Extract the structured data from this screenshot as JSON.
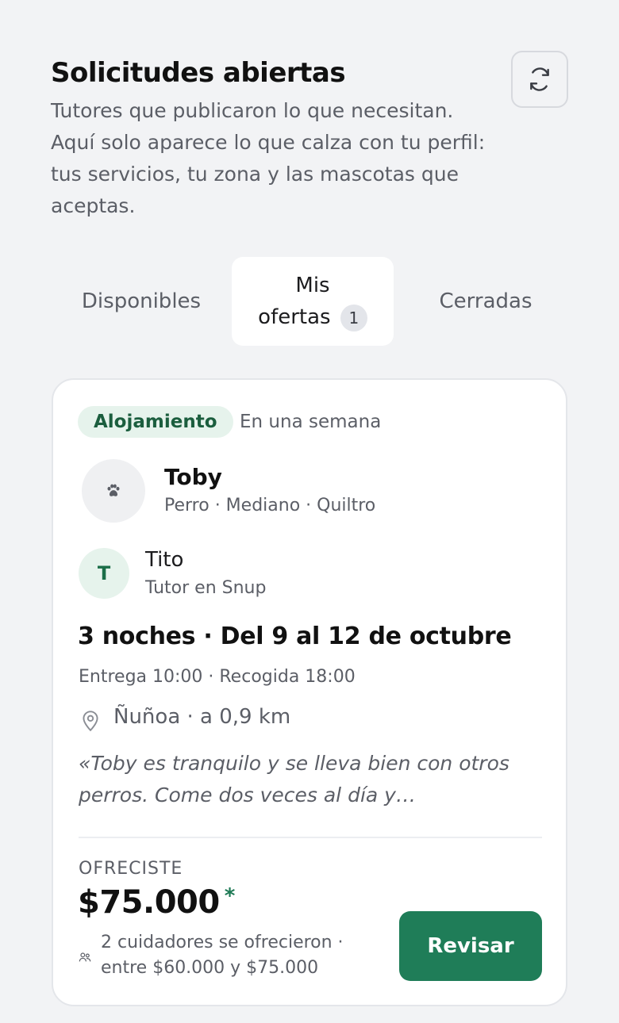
{
  "header": {
    "title": "Solicitudes abiertas",
    "subtitle": "Tutores que publicaron lo que necesitan. Aquí solo aparece lo que calza con tu perfil: tus servicios, tu zona y las mascotas que aceptas.",
    "refresh_icon": "refresh-icon"
  },
  "tabs": {
    "available": "Disponibles",
    "mine_line1": "Mis",
    "mine_line2": "ofertas",
    "mine_count": "1",
    "closed": "Cerradas",
    "active": "mine"
  },
  "card": {
    "service": "Alojamiento",
    "when": "En una semana",
    "pet_icon": "paw-icon",
    "pet_name": "Toby",
    "pet_meta": "Perro · Mediano · Quiltro",
    "owner_initial": "T",
    "owner_name": "Tito",
    "owner_role": "Tutor en Snup",
    "stay": "3 noches · Del 9 al 12 de octubre",
    "times": "Entrega 10:00 · Recogida 18:00",
    "location_icon": "location-pin-icon",
    "location": "Ñuñoa · a 0,9 km",
    "note": "«Toby es tranquilo y se lleva bien con otros perros. Come dos veces al día y…",
    "offer_label": "OFRECISTE",
    "offer_amount": "$75.000",
    "offer_mark": "*",
    "people_icon": "people-icon",
    "range_line1": "2 cuidadores se ofrecieron ·",
    "range_line2": "entre $60.000 y $75.000",
    "review_label": "Revisar"
  },
  "colors": {
    "accent": "#1f7d58",
    "chip_bg": "#e6f3ec",
    "background": "#f2f3f5"
  }
}
